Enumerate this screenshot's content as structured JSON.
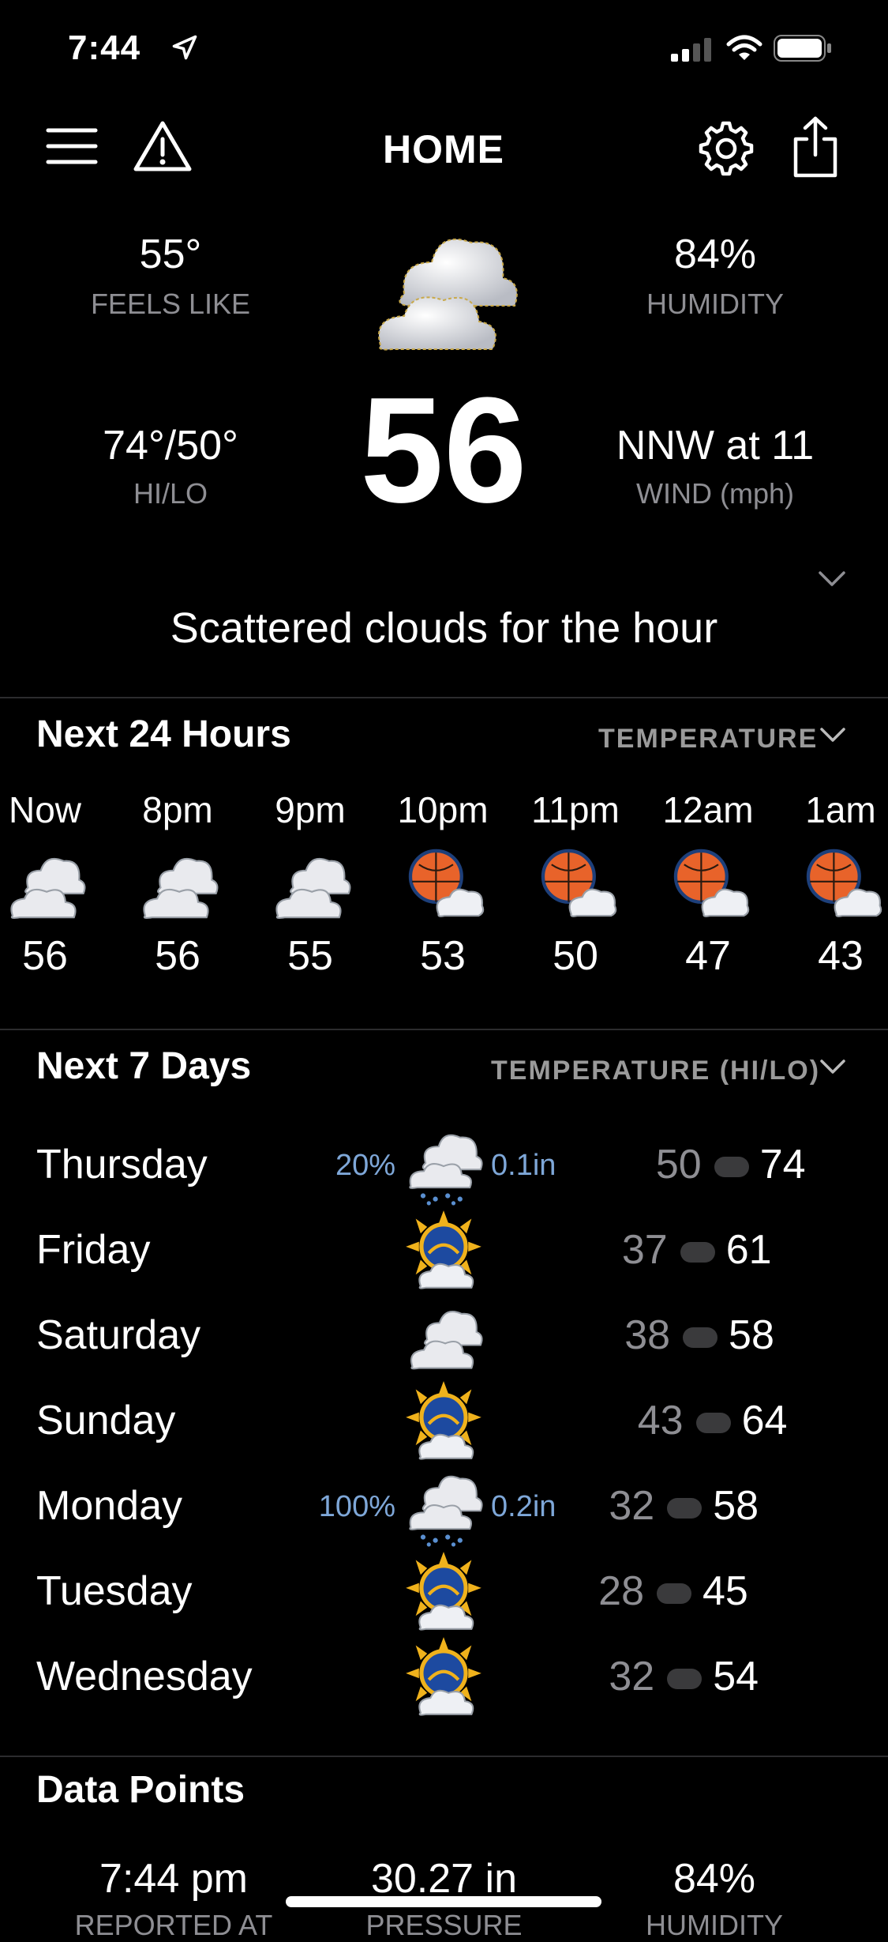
{
  "status_bar": {
    "time": "7:44"
  },
  "header": {
    "title": "HOME"
  },
  "current": {
    "feels_like_value": "55°",
    "feels_like_label": "FEELS LIKE",
    "humidity_value": "84%",
    "humidity_label": "HUMIDITY",
    "hilo_value": "74°/50°",
    "hilo_label": "HI/LO",
    "temperature": "56",
    "wind_value": "NNW at 11",
    "wind_label": "WIND (mph)",
    "summary": "Scattered clouds for the hour"
  },
  "hourly": {
    "title": "Next 24 Hours",
    "selector": "TEMPERATURE",
    "items": [
      {
        "time": "Now",
        "temp": "56",
        "icon": "cloudy-icon"
      },
      {
        "time": "8pm",
        "temp": "56",
        "icon": "cloudy-icon"
      },
      {
        "time": "9pm",
        "temp": "55",
        "icon": "cloudy-icon"
      },
      {
        "time": "10pm",
        "temp": "53",
        "icon": "night-cloud-icon"
      },
      {
        "time": "11pm",
        "temp": "50",
        "icon": "night-cloud-icon"
      },
      {
        "time": "12am",
        "temp": "47",
        "icon": "night-cloud-icon"
      },
      {
        "time": "1am",
        "temp": "43",
        "icon": "night-cloud-icon"
      }
    ]
  },
  "daily": {
    "title": "Next 7 Days",
    "selector": "TEMPERATURE (HI/LO)",
    "items": [
      {
        "day": "Thursday",
        "precip_pct": "20%",
        "precip_amt": "0.1in",
        "lo": "50",
        "hi": "74",
        "icon": "rain-cloud-icon"
      },
      {
        "day": "Friday",
        "precip_pct": "",
        "precip_amt": "",
        "lo": "37",
        "hi": "61",
        "icon": "partly-sunny-icon"
      },
      {
        "day": "Saturday",
        "precip_pct": "",
        "precip_amt": "",
        "lo": "38",
        "hi": "58",
        "icon": "cloudy-icon"
      },
      {
        "day": "Sunday",
        "precip_pct": "",
        "precip_amt": "",
        "lo": "43",
        "hi": "64",
        "icon": "partly-sunny-icon"
      },
      {
        "day": "Monday",
        "precip_pct": "100%",
        "precip_amt": "0.2in",
        "lo": "32",
        "hi": "58",
        "icon": "rain-cloud-icon"
      },
      {
        "day": "Tuesday",
        "precip_pct": "",
        "precip_amt": "",
        "lo": "28",
        "hi": "45",
        "icon": "partly-sunny-icon"
      },
      {
        "day": "Wednesday",
        "precip_pct": "",
        "precip_amt": "",
        "lo": "32",
        "hi": "54",
        "icon": "partly-sunny-icon"
      }
    ]
  },
  "data_points": {
    "title": "Data Points",
    "reported_at_value": "7:44 pm",
    "reported_at_label": "REPORTED AT",
    "pressure_value": "30.27 in",
    "pressure_label": "PRESSURE",
    "humidity_value": "84%",
    "humidity_label": "HUMIDITY"
  },
  "colors": {
    "background": "#000000",
    "accent_precip": "#7ea7d8",
    "muted": "#8e8e93"
  }
}
